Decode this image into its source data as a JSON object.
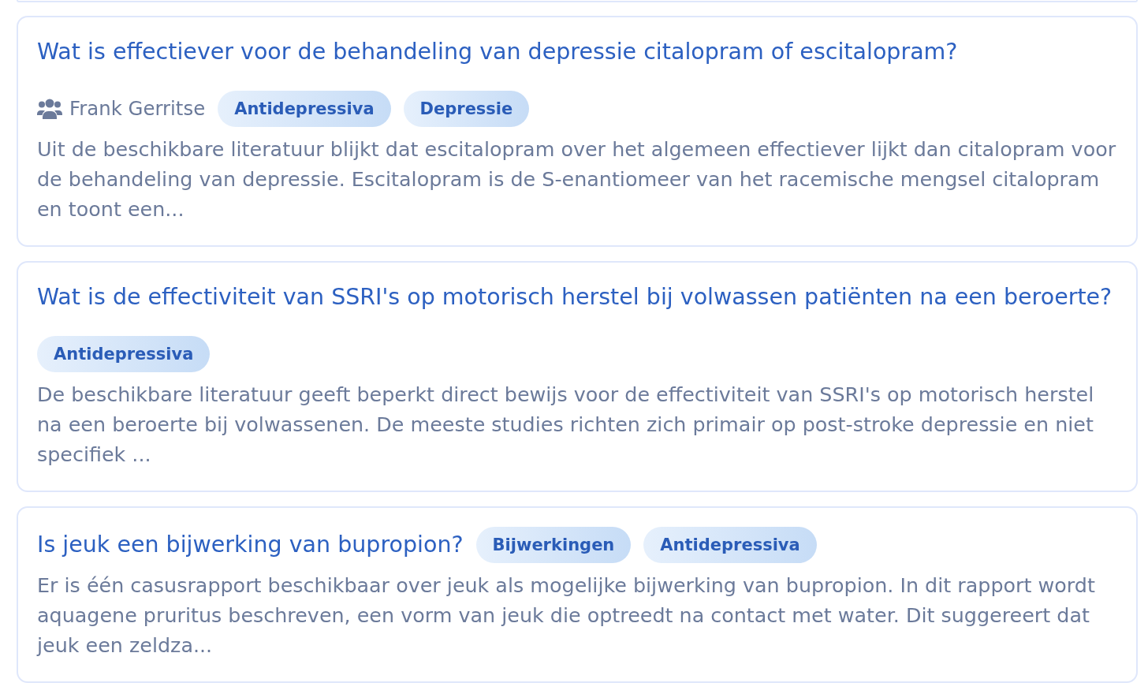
{
  "cards": [
    {
      "title": "Wat is effectiever voor de behandeling van depressie citalopram of escitalopram?",
      "author": "Frank Gerritse",
      "tags": [
        "Antidepressiva",
        "Depressie"
      ],
      "summary": "Uit de beschikbare literatuur blijkt dat escitalopram over het algemeen effectiever lijkt dan citalopram voor de behandeling van depressie. Escitalopram is de S-enantiomeer van het racemische mengsel citalopram en toont een..."
    },
    {
      "title": "Wat is de effectiviteit van SSRI's op motorisch herstel bij volwassen patiënten na een beroerte?",
      "tags": [
        "Antidepressiva"
      ],
      "summary": "De beschikbare literatuur geeft beperkt direct bewijs voor de effectiviteit van SSRI's op motorisch herstel na een beroerte bij volwassenen. De meeste studies richten zich primair op post-stroke depressie en niet specifiek ..."
    },
    {
      "title": "Is jeuk een bijwerking van bupropion?",
      "tags": [
        "Bijwerkingen",
        "Antidepressiva"
      ],
      "summary": "Er is één casusrapport beschikbaar over jeuk als mogelijke bijwerking van bupropion. In dit rapport wordt aquagene pruritus beschreven, een vorm van jeuk die optreedt na contact met water. Dit suggereert dat jeuk een zeldza..."
    }
  ]
}
